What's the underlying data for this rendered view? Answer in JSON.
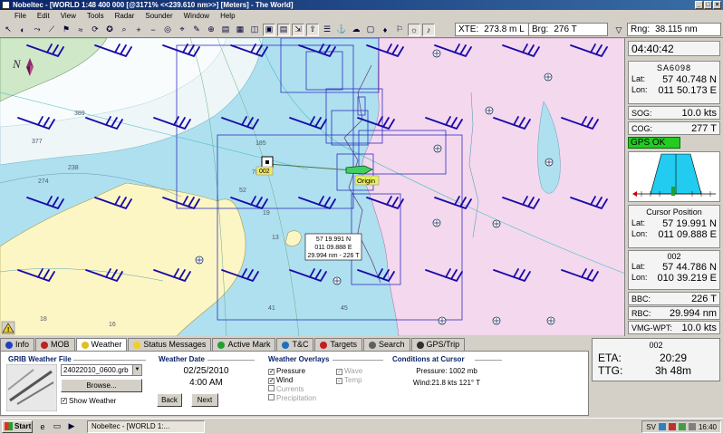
{
  "window": {
    "title": "Nobeltec - [WORLD 1:48 400 000 [@3171% <<239.610 nm>>] [Meters] - The World]"
  },
  "menu": [
    "File",
    "Edit",
    "View",
    "Tools",
    "Radar",
    "Sounder",
    "Window",
    "Help"
  ],
  "nav": {
    "xte_label": "XTE:",
    "xte_value": "273.8 m L",
    "brg_label": "Brg:",
    "brg_value": "276 T",
    "rng_label": "Rng:",
    "rng_value": "38.115 nm"
  },
  "map": {
    "north_label": "N",
    "waypoint_label": "002",
    "origin_label": "Origin",
    "cursor_tip": [
      "57 19.991 N",
      "011 09.888 E",
      "29.994 nm - 226 T"
    ],
    "depths": [
      "389",
      "377",
      "274",
      "238",
      "185",
      "78",
      "52",
      "19",
      "13",
      "41",
      "45",
      "18",
      "16"
    ]
  },
  "right_panel": {
    "time": "04:40:42",
    "vessel": "SA6098",
    "lat_label": "Lat:",
    "lon_label": "Lon:",
    "vessel_lat": "57 40.748 N",
    "vessel_lon": "011 50.173 E",
    "sog_label": "SOG:",
    "sog": "10.0 kts",
    "cog_label": "COG:",
    "cog": "277 T",
    "gps_status": "GPS OK",
    "cursor_title": "Cursor Position",
    "cursor_lat": "57 19.991 N",
    "cursor_lon": "011 09.888 E",
    "wp_title": "002",
    "wp_lat": "57 44.786 N",
    "wp_lon": "010 39.219 E",
    "bbc_label": "BBC:",
    "bbc": "226 T",
    "rbc_label": "RBC:",
    "rbc": "29.994 nm",
    "vmg_label": "VMG-WPT:",
    "vmg": "10.0 kts"
  },
  "tabs": [
    "Info",
    "MOB",
    "Weather",
    "Status Messages",
    "Active Mark",
    "T&C",
    "Targets",
    "Search",
    "GPS/Trip"
  ],
  "weather": {
    "grib_title": "GRIB Weather File",
    "grib_file": "24022010_0600.grb",
    "browse": "Browse...",
    "show_weather": "Show Weather",
    "date_title": "Weather Date",
    "date": "02/25/2010",
    "time": "4:00 AM",
    "back": "Back",
    "next": "Next",
    "overlays_title": "Weather Overlays",
    "overlays": [
      "Pressure",
      "Wind",
      "Currents",
      "Precipitation"
    ],
    "overlays_right": [
      "Wave",
      "Temp"
    ],
    "conditions_title": "Conditions at Cursor",
    "pressure": "Pressure: 1002 mb",
    "wind": "Wind:21.8 kts 121° T"
  },
  "eta_panel": {
    "title": "002",
    "eta_label": "ETA:",
    "eta": "20:29",
    "ttg_label": "TTG:",
    "ttg": "3h 48m"
  },
  "taskbar": {
    "start": "Start",
    "task": "Nobeltec - [WORLD 1:...",
    "lang": "SV",
    "clock": "16:40"
  },
  "colors": {
    "water": "#aee0ef",
    "deep_water": "#eef6f8",
    "land_yellow": "#fcf6c4",
    "land_pink": "#f4d8ee",
    "wind_barb": "#1a0aa8",
    "gps_ok": "#22cc22"
  }
}
